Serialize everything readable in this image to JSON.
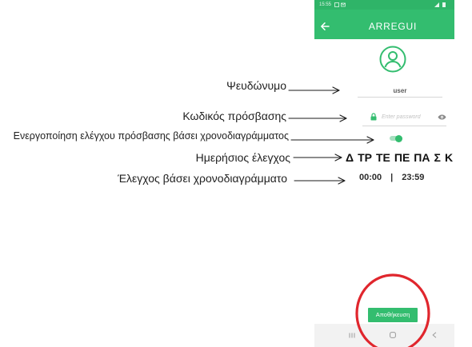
{
  "status_bar": {
    "time": "15:55"
  },
  "app_bar": {
    "logo": "ARREGUI",
    "back_icon": "arrow-left-icon"
  },
  "profile": {
    "avatar_icon": "user-circle-icon"
  },
  "username_field": {
    "value": "user"
  },
  "password_field": {
    "placeholder": "Enter password",
    "lock_icon": "lock-icon",
    "toggle_visibility_icon": "eye-icon"
  },
  "schedule_toggle": {
    "on": true
  },
  "days": [
    "Δ",
    "ΤΡ",
    "ΤΕ",
    "ΠΕ",
    "ΠΑ",
    "Σ",
    "Κ"
  ],
  "schedule_time": {
    "start": "00:00",
    "separator": "|",
    "end": "23:59"
  },
  "save_button": {
    "label": "Αποθήκευση"
  },
  "nav_bar": {
    "recents_icon": "recent-apps-icon",
    "home_icon": "home-icon",
    "back_icon": "back-chevron-icon"
  },
  "annotations": [
    "Ψευδώνυμο",
    "Κωδικός πρόσβασης",
    "Ενεργοποίηση ελέγχου πρόσβασης βάσει χρονοδιαγράμματος",
    "Ημερήσιος έλεγχος",
    "Έλεγχος βάσει χρονοδιαγράμματο"
  ],
  "colors": {
    "brand_green": "#33bd6f",
    "status_green": "#2fb468",
    "highlight_red": "#e0262d",
    "annotation_text": "#1f1f1f"
  }
}
